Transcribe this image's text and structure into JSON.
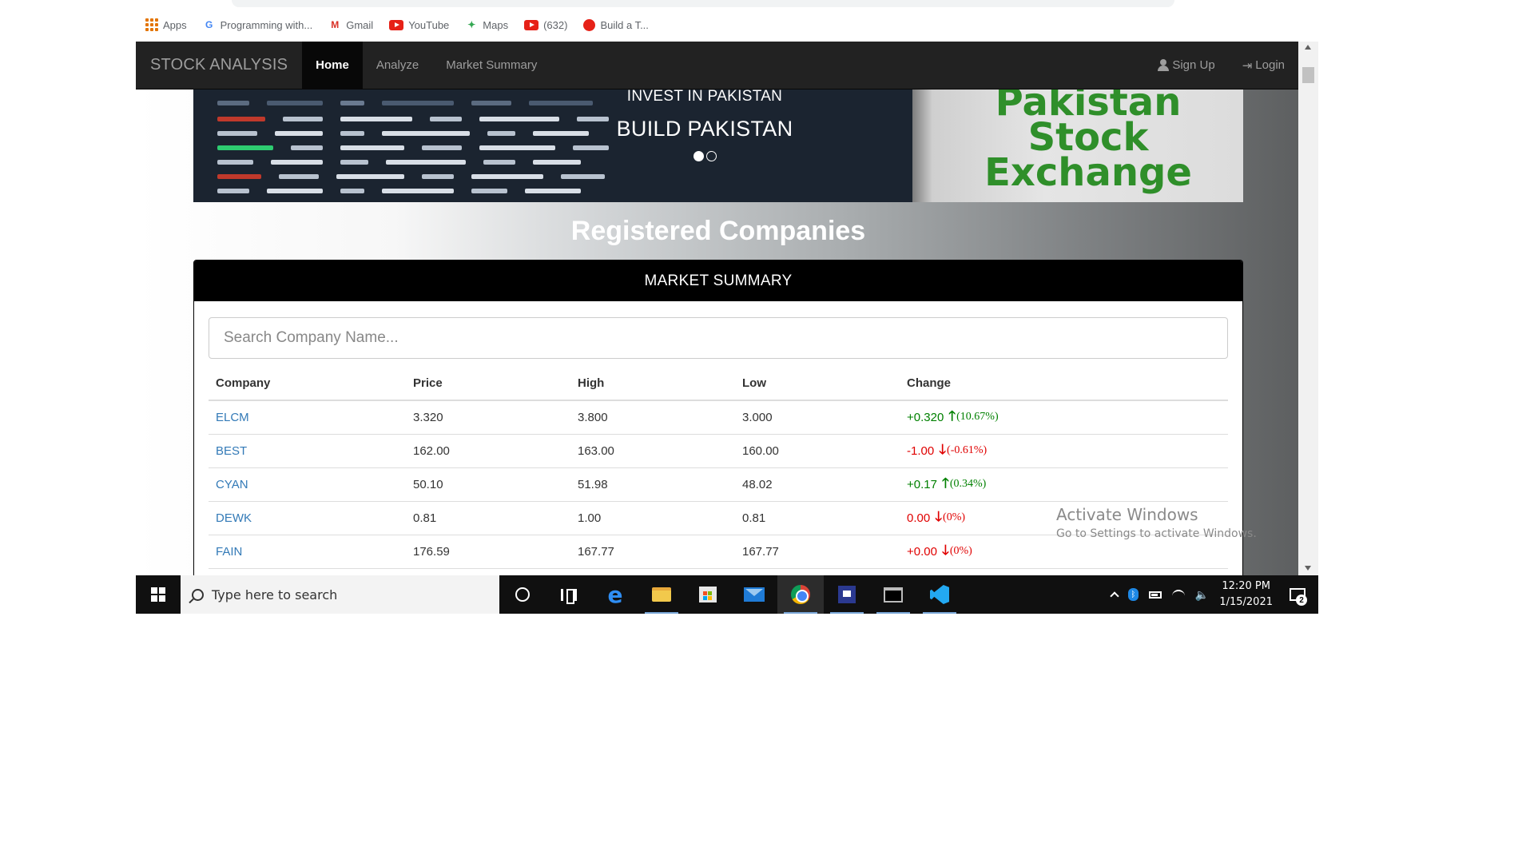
{
  "bookmarks": [
    {
      "icon": "apps-grid-icon",
      "label": "Apps"
    },
    {
      "icon": "google-icon",
      "label": "Programming with..."
    },
    {
      "icon": "gmail-icon",
      "label": "Gmail"
    },
    {
      "icon": "youtube-icon",
      "label": "YouTube"
    },
    {
      "icon": "maps-icon",
      "label": "Maps"
    },
    {
      "icon": "youtube-icon",
      "label": "(632)"
    },
    {
      "icon": "record-icon",
      "label": "Build a T..."
    }
  ],
  "navbar": {
    "brand": "STOCK ANALYSIS",
    "links": [
      "Home",
      "Analyze",
      "Market Summary"
    ],
    "active": "Home",
    "signup": "Sign Up",
    "login": "Login"
  },
  "carousel": {
    "subtitle": "INVEST IN PAKISTAN",
    "title": "BUILD PAKISTAN",
    "logo_lines": [
      "Pakistan",
      "Stock",
      "Exchange"
    ],
    "slide_count": 2,
    "active_slide": 1
  },
  "section_title": "Registered Companies",
  "panel": {
    "heading": "MARKET SUMMARY",
    "search_placeholder": "Search Company Name..."
  },
  "table": {
    "headers": [
      "Company",
      "Price",
      "High",
      "Low",
      "Change"
    ],
    "rows": [
      {
        "company": "ELCM",
        "price": "3.320",
        "high": "3.800",
        "low": "3.000",
        "change": "+0.320",
        "pct": "(10.67%)",
        "direction": "up"
      },
      {
        "company": "BEST",
        "price": "162.00",
        "high": "163.00",
        "low": "160.00",
        "change": "-1.00",
        "pct": "(-0.61%)",
        "direction": "down"
      },
      {
        "company": "CYAN",
        "price": "50.10",
        "high": "51.98",
        "low": "48.02",
        "change": "+0.17",
        "pct": "(0.34%)",
        "direction": "up"
      },
      {
        "company": "DEWK",
        "price": "0.81",
        "high": "1.00",
        "low": "0.81",
        "change": "0.00",
        "pct": "(0%)",
        "direction": "down"
      },
      {
        "company": "FAIN",
        "price": "176.59",
        "high": "167.77",
        "low": "167.77",
        "change": "+0.00",
        "pct": "(0%)",
        "direction": "down"
      }
    ]
  },
  "watermark": {
    "title": "Activate Windows",
    "subtitle": "Go to Settings to activate Windows."
  },
  "taskbar": {
    "search_placeholder": "Type here to search",
    "time": "12:20 PM",
    "date": "1/15/2021",
    "notification_count": "2"
  },
  "colors": {
    "navbar": "#222222",
    "link": "#337ab7",
    "up": "#008000",
    "down": "#e00000"
  }
}
